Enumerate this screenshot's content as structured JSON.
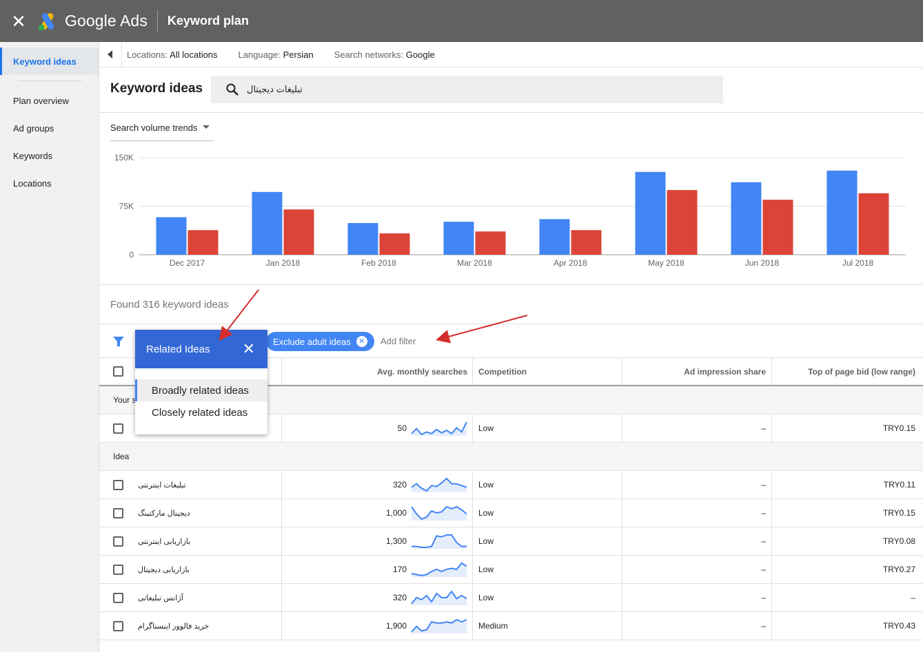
{
  "topbar": {
    "brand": "Google Ads",
    "page_title": "Keyword plan"
  },
  "sidebar": {
    "items": [
      {
        "label": "Keyword ideas",
        "active": true
      },
      {
        "label": "Plan overview"
      },
      {
        "label": "Ad groups"
      },
      {
        "label": "Keywords"
      },
      {
        "label": "Locations"
      }
    ]
  },
  "locbar": {
    "locations_label": "Locations:",
    "locations_value": "All locations",
    "language_label": "Language:",
    "language_value": "Persian",
    "networks_label": "Search networks:",
    "networks_value": "Google"
  },
  "header": {
    "title": "Keyword ideas",
    "search_value": "تبلیغات دیجیتال"
  },
  "trend_selector": "Search volume trends",
  "chart_data": {
    "type": "bar",
    "categories": [
      "Dec 2017",
      "Jan 2018",
      "Feb 2018",
      "Mar 2018",
      "Apr 2018",
      "May 2018",
      "Jun 2018",
      "Jul 2018"
    ],
    "series": [
      {
        "values": [
          58000,
          97000,
          49000,
          51000,
          55000,
          128000,
          112000,
          130000
        ],
        "color": "#4285f4"
      },
      {
        "values": [
          38000,
          70000,
          33000,
          36000,
          38000,
          100000,
          85000,
          95000
        ],
        "color": "#db4437"
      }
    ],
    "yticks": [
      "150K",
      "75K",
      "0"
    ],
    "ylim": [
      0,
      150000
    ]
  },
  "found_text": "Found 316 keyword ideas",
  "filterbar": {
    "chip_label": "Exclude adult ideas",
    "add_filter": "Add filter"
  },
  "popup": {
    "title": "Related Ideas",
    "options": [
      "Broadly related ideas",
      "Closely related ideas"
    ]
  },
  "table": {
    "headers": {
      "avg": "Avg. monthly searches",
      "competition": "Competition",
      "ais": "Ad impression share",
      "bid": "Top of page bid (low range)"
    },
    "group_your": "Your s",
    "your_row": {
      "avg": "50",
      "competition": "Low",
      "ais": "–",
      "bid": "TRY0.15",
      "trend": [
        4,
        10,
        3,
        6,
        4,
        9,
        5,
        8,
        4,
        11,
        6,
        18
      ]
    },
    "group_idea": "Idea",
    "rows": [
      {
        "keyword": "تبلیغات اینترنتی",
        "avg": "320",
        "competition": "Low",
        "ais": "–",
        "bid": "TRY0.11",
        "trend": [
          8,
          12,
          7,
          4,
          10,
          9,
          13,
          18,
          12,
          12,
          10,
          8
        ]
      },
      {
        "keyword": "دیجیتال مارکتینگ",
        "avg": "1,000",
        "competition": "Low",
        "ais": "–",
        "bid": "TRY0.15",
        "trend": [
          15,
          8,
          3,
          5,
          11,
          9,
          10,
          15,
          13,
          15,
          12,
          8
        ]
      },
      {
        "keyword": "بازاریابی اینترنتی",
        "avg": "1,300",
        "competition": "Low",
        "ais": "–",
        "bid": "TRY0.08",
        "trend": [
          4,
          4,
          3,
          3,
          4,
          15,
          14,
          16,
          16,
          8,
          4,
          4
        ]
      },
      {
        "keyword": "بازاریابی دیجیتال",
        "avg": "170",
        "competition": "Low",
        "ais": "–",
        "bid": "TRY0.27",
        "trend": [
          4,
          3,
          2,
          3,
          6,
          8,
          6,
          8,
          9,
          8,
          14,
          11
        ]
      },
      {
        "keyword": "آژانس تبلیغاتی",
        "avg": "320",
        "competition": "Low",
        "ais": "–",
        "bid": "–",
        "trend": [
          4,
          10,
          8,
          12,
          6,
          14,
          10,
          10,
          16,
          9,
          12,
          9
        ]
      },
      {
        "keyword": "خرید فالوور اینستاگرام",
        "avg": "1,900",
        "competition": "Medium",
        "ais": "–",
        "bid": "TRY0.43",
        "trend": [
          5,
          10,
          6,
          7,
          14,
          13,
          13,
          14,
          13,
          16,
          14,
          16
        ]
      }
    ]
  },
  "colors": {
    "accent": "#4285f4",
    "red": "#db4437",
    "popup_header": "#3367d6"
  }
}
